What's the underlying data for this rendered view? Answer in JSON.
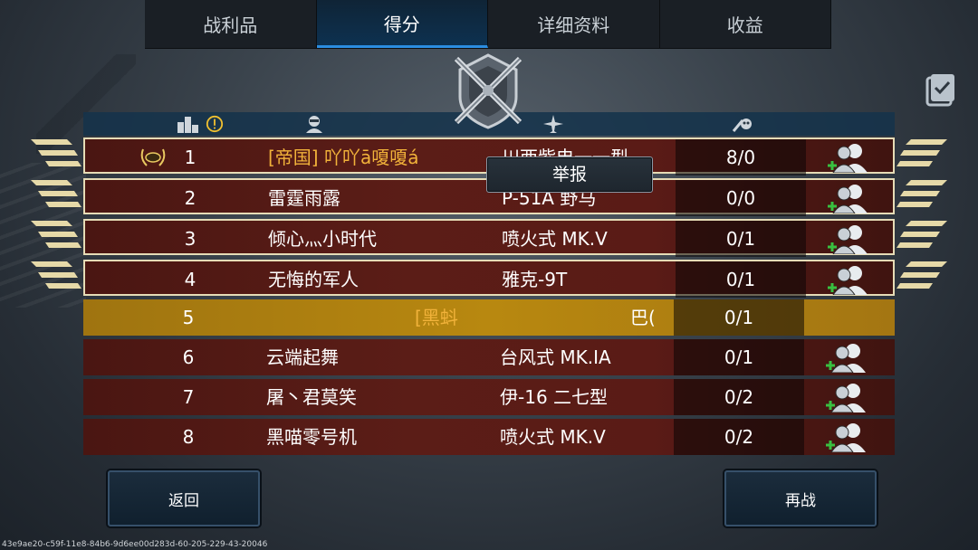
{
  "tabs": [
    {
      "label": "战利品",
      "active": false
    },
    {
      "label": "得分",
      "active": true
    },
    {
      "label": "详细资料",
      "active": false
    },
    {
      "label": "收益",
      "active": false
    }
  ],
  "header_icons": [
    "podium-icon",
    "info-icon",
    "pilot-icon",
    "plane-icon",
    "kill-icon"
  ],
  "popup": {
    "label": "举报"
  },
  "rows": [
    {
      "rank": "1",
      "name": "[帝国] 吖吖ā嗄嗄á",
      "plane": "川西紫电一一型",
      "score": "8/0",
      "style": "red-highlight"
    },
    {
      "rank": "2",
      "name": "雷霆雨露",
      "plane": "P-51A 野马",
      "score": "0/0",
      "style": "red-highlight"
    },
    {
      "rank": "3",
      "name": "倾心灬小时代",
      "plane": "喷火式 MK.V",
      "score": "0/1",
      "style": "red-highlight"
    },
    {
      "rank": "4",
      "name": "无悔的军人",
      "plane": "雅克-9T",
      "score": "0/1",
      "style": "red-highlight"
    },
    {
      "rank": "5",
      "name": "[黑蚪",
      "plane": "巴(",
      "score": "0/1",
      "style": "gold"
    },
    {
      "rank": "6",
      "name": "云端起舞",
      "plane": "台风式 MK.IA",
      "score": "0/1",
      "style": "red"
    },
    {
      "rank": "7",
      "name": "屠丶君莫笑",
      "plane": "伊-16 二七型",
      "score": "0/2",
      "style": "red"
    },
    {
      "rank": "8",
      "name": "黑喵零号机",
      "plane": "喷火式 MK.V",
      "score": "0/2",
      "style": "red"
    }
  ],
  "buttons": {
    "back": "返回",
    "rematch": "再战"
  },
  "footer_id": "43e9ae20-c59f-11e8-84b6-9d6ee00d283d-60-205-229-43-20046",
  "colors": {
    "accent": "#2b8de0",
    "row_red": "#5b1d17",
    "row_gold": "#b88810",
    "clan_text": "#f1b23a",
    "chevron": "#e6d9a8"
  }
}
